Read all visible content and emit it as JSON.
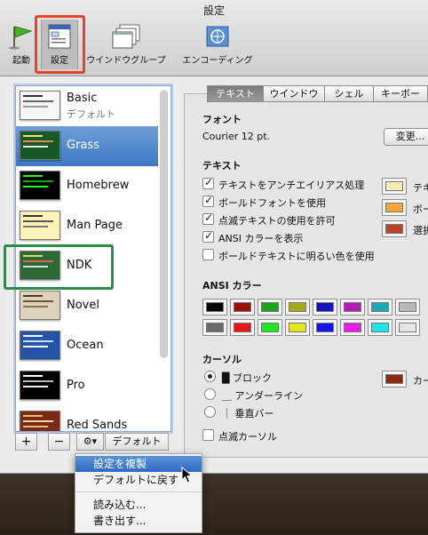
{
  "window": {
    "title": "設定"
  },
  "toolbar": {
    "items": [
      {
        "label": "起動"
      },
      {
        "label": "設定"
      },
      {
        "label": "ウインドウグループ"
      },
      {
        "label": "エンコーディング"
      }
    ]
  },
  "profiles": [
    {
      "name": "Basic",
      "subtitle": "デフォルト"
    },
    {
      "name": "Grass"
    },
    {
      "name": "Homebrew"
    },
    {
      "name": "Man Page"
    },
    {
      "name": "NDK"
    },
    {
      "name": "Novel"
    },
    {
      "name": "Ocean"
    },
    {
      "name": "Pro"
    },
    {
      "name": "Red Sands"
    }
  ],
  "bottom_bar": {
    "add": "+",
    "remove": "−",
    "gear": "⚙▾",
    "default_label": "デフォルト"
  },
  "context_menu": {
    "items": [
      "設定を複製",
      "デフォルトに戻す",
      "読み込む...",
      "書き出す..."
    ]
  },
  "tabs": [
    "テキスト",
    "ウインドウ",
    "シェル",
    "キーボー"
  ],
  "font": {
    "heading": "フォント",
    "value": "Courier 12 pt.",
    "change_button": "変更..."
  },
  "text": {
    "heading": "テキスト",
    "options": [
      {
        "label": "テキストをアンチエイリアス処理",
        "checked": true
      },
      {
        "label": "ボールドフォントを使用",
        "checked": true
      },
      {
        "label": "点滅テキストの使用を許可",
        "checked": true
      },
      {
        "label": "ANSI カラーを表示",
        "checked": true
      },
      {
        "label": "ボールドテキストに明るい色を使用",
        "checked": false
      }
    ],
    "color_labels": [
      "テキ",
      "ボー",
      "選択"
    ],
    "colors": [
      "#f7eeb6",
      "#f0a838",
      "#b8452a"
    ]
  },
  "ansi": {
    "heading": "ANSI カラー",
    "normal": [
      "#000000",
      "#9b0f0f",
      "#1ea41e",
      "#a8a81e",
      "#1414b8",
      "#b41cb4",
      "#1ea8b4",
      "#b8b8b8"
    ],
    "bright": [
      "#6a6a6a",
      "#e61414",
      "#1ee61e",
      "#e6e61e",
      "#1414f0",
      "#e61ee6",
      "#1ee6e6",
      "#e6e6e6"
    ]
  },
  "cursor": {
    "heading": "カーソル",
    "options": [
      {
        "label": "█ ブロック",
        "selected": true
      },
      {
        "label": "＿ アンダーライン",
        "selected": false
      },
      {
        "label": "｜ 垂直バー",
        "selected": false
      }
    ],
    "blink_label": "点滅カーソル",
    "color_label": "カー",
    "color": "#8a2a12"
  },
  "colors": {
    "accent": "#3e78c4",
    "highlight_red": "#e8412c",
    "highlight_green": "#2f8a4f"
  }
}
